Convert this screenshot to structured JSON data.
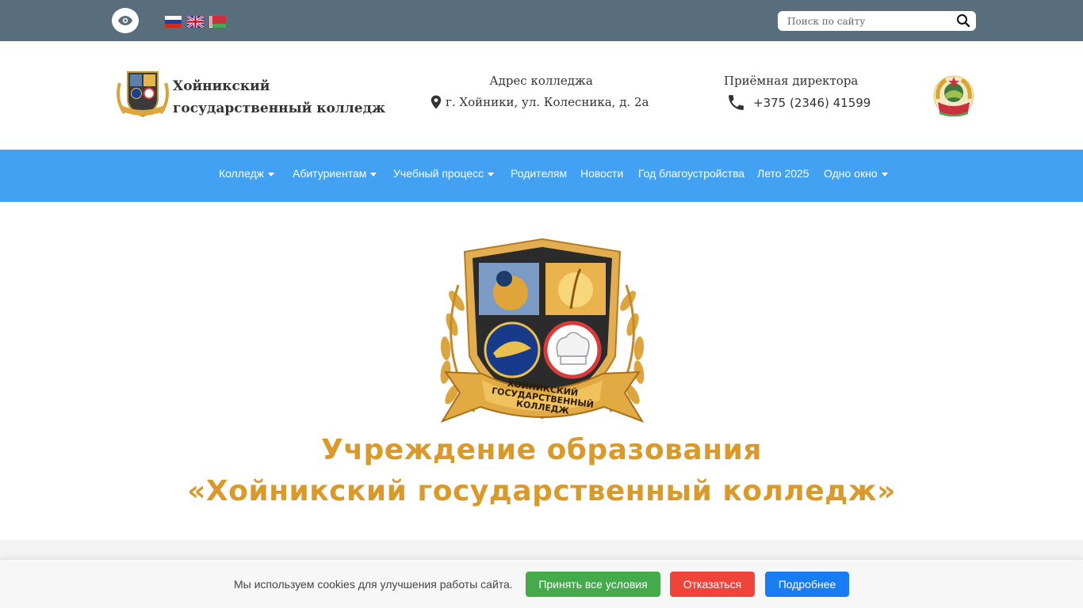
{
  "topbar": {
    "eye_icon": "eye-icon",
    "flags": [
      "flag-ru-icon",
      "flag-uk-icon",
      "flag-by-icon"
    ],
    "search": {
      "placeholder": "Поиск по сайту",
      "icon": "search-icon"
    }
  },
  "header": {
    "college_name": "Хойникский государственный колледж",
    "address": {
      "title": "Адрес колледжа",
      "value": "г. Хойники, ул. Колесника, д. 2а",
      "icon": "map-pin-icon"
    },
    "phone": {
      "title": "Приёмная директора",
      "value": "+375 (2346) 41599",
      "icon": "phone-icon"
    }
  },
  "nav": {
    "items": [
      {
        "label": "Колледж",
        "dropdown": true
      },
      {
        "label": "Абитуриентам",
        "dropdown": true
      },
      {
        "label": "Учебный процесс",
        "dropdown": true
      },
      {
        "label": "Родителям",
        "dropdown": false
      },
      {
        "label": "Новости",
        "dropdown": false
      },
      {
        "label": "Год благоустройства",
        "dropdown": false
      },
      {
        "label": "Лето 2025",
        "dropdown": false
      },
      {
        "label": "Одно окно",
        "dropdown": true
      }
    ]
  },
  "hero": {
    "logo_lettering": "ХОЙНИКСКИЙ ГОСУДАРСТВЕННЫЙ КОЛЛЕДЖ",
    "title_line1": "Учреждение образования",
    "title_line2": "«Хойникский государственный колледж»"
  },
  "cookie": {
    "text": "Мы используем cookies для улучшения работы сайта.",
    "accept": "Принять все условия",
    "decline": "Отказаться",
    "more": "Подробнее"
  },
  "colors": {
    "topbar": "#586e7c",
    "nav": "#42a1f3",
    "hero_title": "#d99a2b",
    "accept": "#44aa4c",
    "decline": "#f0443a",
    "more": "#1a7cf3"
  }
}
